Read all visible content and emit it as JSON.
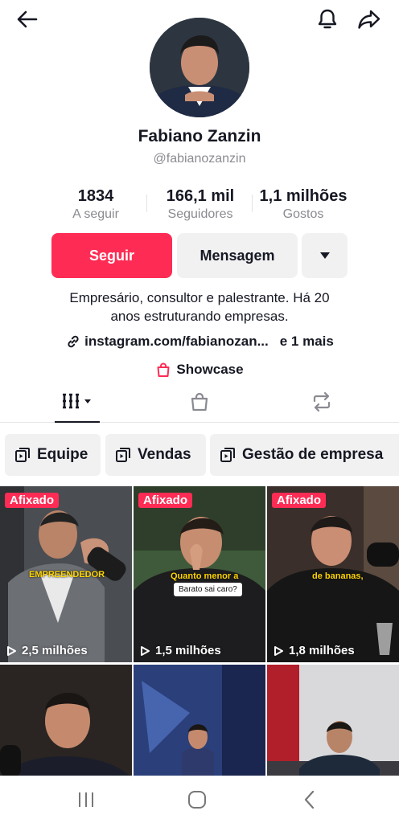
{
  "header": {
    "back_icon": "arrow-left-icon",
    "bell_icon": "bell-icon",
    "share_icon": "share-arrow-icon"
  },
  "profile": {
    "name": "Fabiano Zanzin",
    "handle": "@fabianozanzin",
    "stats": [
      {
        "value": "1834",
        "label": "A seguir"
      },
      {
        "value": "166,1 mil",
        "label": "Seguidores"
      },
      {
        "value": "1,1 milhões",
        "label": "Gostos"
      }
    ],
    "follow_label": "Seguir",
    "message_label": "Mensagem",
    "bio_line1": "Empresário, consultor e palestrante. Há 20",
    "bio_line2": "anos estruturando empresas.",
    "link_text": "instagram.com/fabianozan...",
    "link_more": "e 1 mais",
    "showcase_label": "Showcase"
  },
  "playlists": [
    {
      "label": "Equipe"
    },
    {
      "label": "Vendas"
    },
    {
      "label": "Gestão de empresa"
    }
  ],
  "videos": [
    {
      "pinned": "Afixado",
      "views": "2,5 milhões",
      "caption": "EMPREENDEDOR"
    },
    {
      "pinned": "Afixado",
      "views": "1,5 milhões",
      "caption": "Quanto menor a",
      "caption2": "Barato sai caro?"
    },
    {
      "pinned": "Afixado",
      "views": "1,8 milhões",
      "caption": "de bananas,"
    },
    {
      "pinned": "",
      "views": ""
    },
    {
      "pinned": "",
      "views": ""
    },
    {
      "pinned": "",
      "views": ""
    }
  ],
  "colors": {
    "accent": "#fe2c55",
    "chip_bg": "#f1f1f2",
    "secondary_text": "#8a8b91"
  }
}
